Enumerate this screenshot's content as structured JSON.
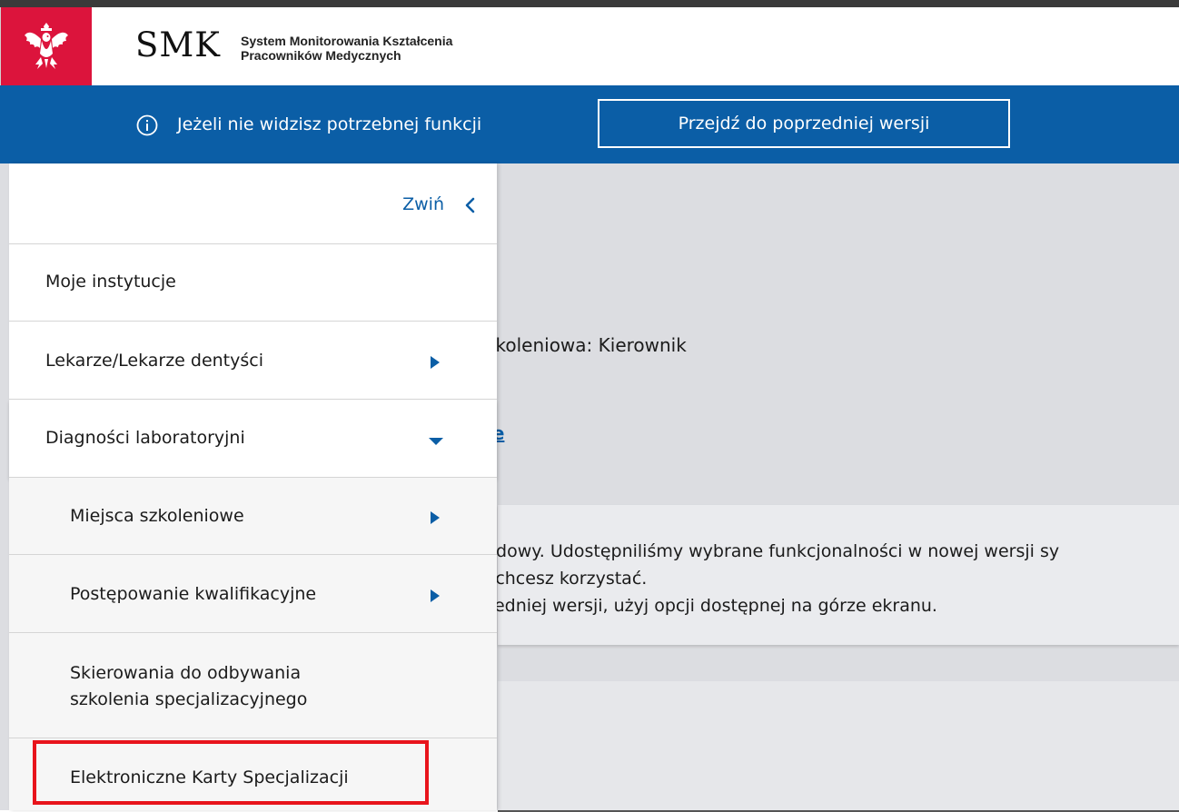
{
  "header": {
    "logo_text": "SMK",
    "subtitle_line1": "System Monitorowania Kształcenia",
    "subtitle_line2": "Pracowników Medycznych",
    "emblem_icon": "polish-eagle-emblem",
    "emblem_bg": "#dc143c"
  },
  "banner": {
    "info_icon": "info-circle-icon",
    "text": "Jeżeli nie widzisz potrzebnej funkcji",
    "button_label": "Przejdź do poprzedniej wersji",
    "bg": "#0b5ea6"
  },
  "sidebar": {
    "collapse_label": "Zwiń",
    "collapse_icon": "chevron-left-icon",
    "items": [
      {
        "label": "Moje instytucje"
      },
      {
        "label": "Lekarze/Lekarze dentyści",
        "icon": "caret-right-icon"
      },
      {
        "label": "Diagności laboratoryjni",
        "icon": "caret-down-icon",
        "expanded": true
      },
      {
        "label": "Miejsca szkoleniowe",
        "icon": "caret-right-icon"
      },
      {
        "label": "Postępowanie kwalifikacyjne",
        "icon": "caret-right-icon"
      },
      {
        "label_line1": "Skierowania do odbywania",
        "label_line2": "szkolenia specjalizacyjnego"
      },
      {
        "label": "Elektroniczne Karty Specjalizacji",
        "highlighted": true
      }
    ]
  },
  "content": {
    "role_text": "zkoleniowa: Kierownik",
    "link_text": "je",
    "notice_line1": "udowy. Udostępniliśmy wybrane funkcjonalności w nowej wersji sy",
    "notice_line2": "j chcesz korzystać.",
    "notice_line3": "zedniej wersji, użyj opcji dostępnej na górze ekranu."
  },
  "colors": {
    "accent": "#0b5ea6",
    "highlight": "#e8141c",
    "content_bg": "#dcdde1"
  }
}
